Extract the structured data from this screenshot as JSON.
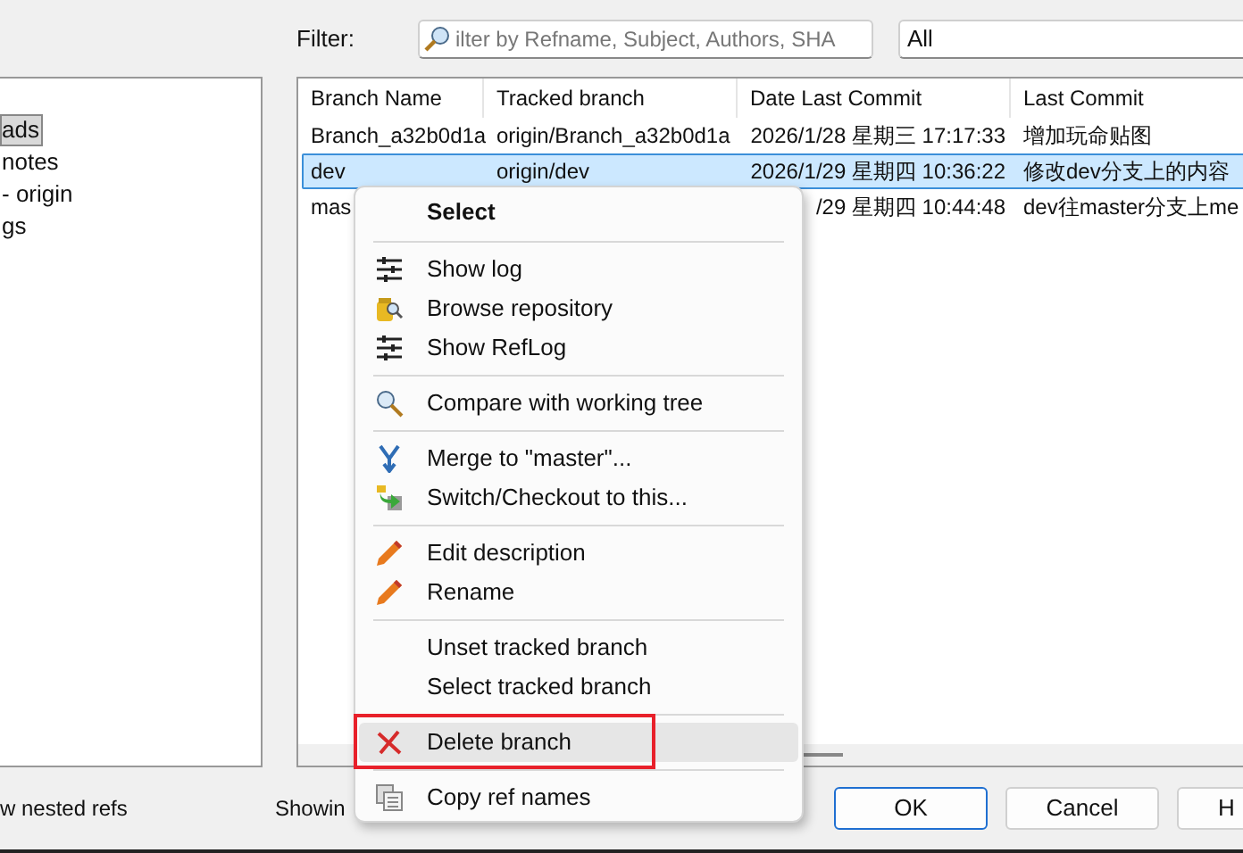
{
  "filter": {
    "label": "Filter:",
    "placeholder": "ilter by Refname, Subject, Authors, SHA",
    "scope": "All"
  },
  "tree": {
    "items": [
      {
        "label": "ads",
        "selected": true
      },
      {
        "label": "notes",
        "selected": false
      },
      {
        "label": "- origin",
        "selected": false
      },
      {
        "label": "gs",
        "selected": false
      }
    ]
  },
  "table": {
    "columns": [
      "Branch Name",
      "Tracked branch",
      "Date Last Commit",
      "Last Commit"
    ],
    "rows": [
      {
        "selected": false,
        "cells": [
          "Branch_a32b0d1a",
          "origin/Branch_a32b0d1a",
          "2026/1/28 星期三 17:17:33",
          "增加玩命贴图"
        ]
      },
      {
        "selected": true,
        "cells": [
          "dev",
          "origin/dev",
          "2026/1/29 星期四 10:36:22",
          "修改dev分支上的内容"
        ]
      },
      {
        "selected": false,
        "cells": [
          "mas",
          "",
          "/29 星期四 10:44:48",
          "dev往master分支上me"
        ]
      }
    ]
  },
  "options": {
    "nested_refs": "w nested refs",
    "showing": "Showin"
  },
  "buttons": [
    {
      "label": "OK",
      "default": true
    },
    {
      "label": "Cancel",
      "default": false
    },
    {
      "label": "H",
      "default": false
    }
  ],
  "menu": [
    {
      "kind": "header",
      "label": "Select"
    },
    {
      "kind": "separator"
    },
    {
      "kind": "item",
      "label": "Show log",
      "highlighted": false,
      "annotated": false
    },
    {
      "kind": "item",
      "label": "Browse repository",
      "highlighted": false,
      "annotated": false
    },
    {
      "kind": "item",
      "label": "Show RefLog",
      "highlighted": false,
      "annotated": false
    },
    {
      "kind": "separator"
    },
    {
      "kind": "item",
      "label": "Compare with working tree",
      "highlighted": false,
      "annotated": false
    },
    {
      "kind": "separator"
    },
    {
      "kind": "item",
      "label": "Merge to \"master\"...",
      "highlighted": false,
      "annotated": false
    },
    {
      "kind": "item",
      "label": "Switch/Checkout to this...",
      "highlighted": false,
      "annotated": false
    },
    {
      "kind": "separator"
    },
    {
      "kind": "item",
      "label": "Edit description",
      "highlighted": false,
      "annotated": false
    },
    {
      "kind": "item",
      "label": "Rename",
      "highlighted": false,
      "annotated": false
    },
    {
      "kind": "separator"
    },
    {
      "kind": "item",
      "label": "Unset tracked branch",
      "highlighted": false,
      "annotated": false
    },
    {
      "kind": "item",
      "label": "Select tracked branch",
      "highlighted": false,
      "annotated": false
    },
    {
      "kind": "separator"
    },
    {
      "kind": "item",
      "label": "Delete branch",
      "highlighted": true,
      "annotated": true
    },
    {
      "kind": "separator"
    },
    {
      "kind": "item",
      "label": "Copy ref names",
      "highlighted": false,
      "annotated": false
    }
  ]
}
